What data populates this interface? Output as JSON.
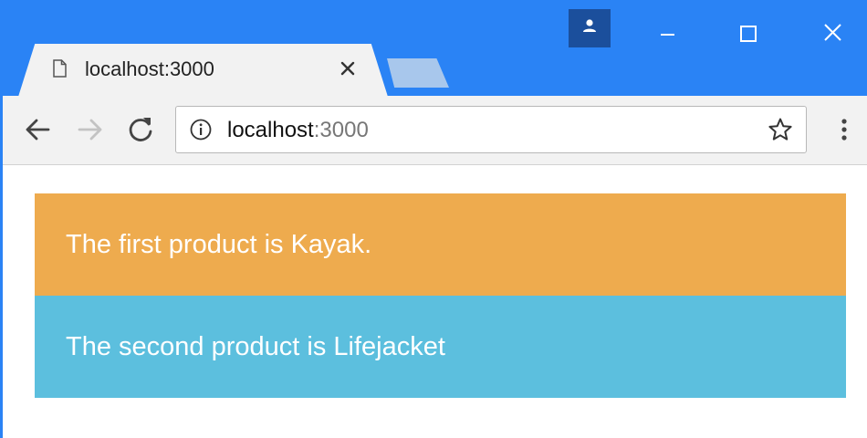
{
  "browser": {
    "tab": {
      "title": "localhost:3000"
    },
    "url": {
      "host": "localhost",
      "port": ":3000"
    }
  },
  "icons": {
    "tab": "document-icon",
    "close": "close-icon",
    "profile": "person-icon",
    "back": "arrow-left-icon",
    "forward": "arrow-right-icon",
    "reload": "reload-icon",
    "info": "info-icon",
    "star": "star-icon",
    "menu": "more-vertical-icon"
  },
  "colors": {
    "chrome_blue": "#2a83f5",
    "toolbar": "#f2f2f2",
    "first_panel": "#eeab4e",
    "second_panel": "#5cbfde"
  },
  "content": {
    "products": [
      {
        "text": "The first product is Kayak."
      },
      {
        "text": "The second product is Lifejacket"
      }
    ]
  }
}
